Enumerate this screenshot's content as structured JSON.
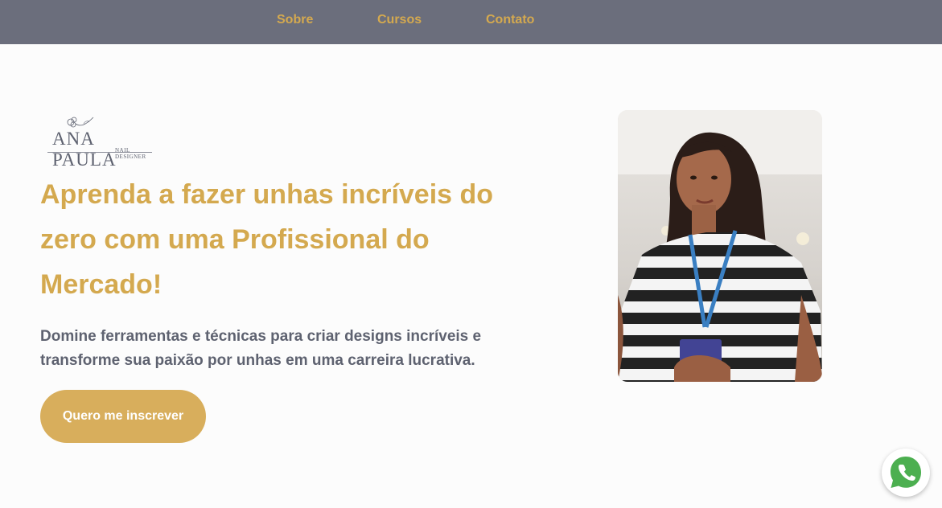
{
  "nav": {
    "items": [
      {
        "label": "Sobre"
      },
      {
        "label": "Cursos"
      },
      {
        "label": "Contato"
      }
    ],
    "background_color": "#6b6e7c",
    "link_color": "#d4a94f"
  },
  "logo": {
    "name": "ANA PAULA",
    "subtitle": "NAIL DESIGNER",
    "icon": "flower-icon"
  },
  "hero": {
    "headline": "Aprenda a fazer unhas incríveis do zero com uma Profissional do Mercado!",
    "subtext": "Domine ferramentas e técnicas para criar designs incríveis e transforme sua paixão por unhas em uma carreira lucrativa.",
    "cta_label": "Quero me inscrever",
    "accent_color": "#d4a94f"
  },
  "photo": {
    "description_icon": "profile-photo"
  },
  "whatsapp": {
    "icon": "whatsapp-icon",
    "color": "#4caf50"
  }
}
